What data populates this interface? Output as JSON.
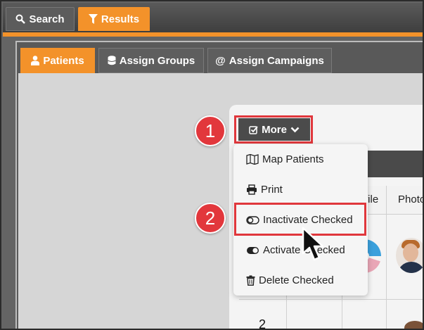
{
  "top_tabs": [
    {
      "label": "Search",
      "icon": "search-icon",
      "active": false
    },
    {
      "label": "Results",
      "icon": "filter-icon",
      "active": true
    }
  ],
  "sub_tabs": [
    {
      "label": "Patients",
      "icon": "user-icon",
      "active": true
    },
    {
      "label": "Assign Groups",
      "icon": "database-icon",
      "active": false
    },
    {
      "label": "Assign Campaigns",
      "icon": "at-icon",
      "active": false
    }
  ],
  "more_button": {
    "label": "More",
    "icon": "check-square-icon",
    "chevron": "chevron-down-icon"
  },
  "menu": {
    "items": [
      {
        "label": "Map Patients",
        "icon": "map-icon"
      },
      {
        "label": "Print",
        "icon": "print-icon"
      },
      {
        "label": "Inactivate Checked",
        "icon": "toggle-off-icon"
      },
      {
        "label": "Activate Checked",
        "icon": "toggle-on-icon"
      },
      {
        "label": "Delete Checked",
        "icon": "trash-icon"
      }
    ]
  },
  "table": {
    "headers": [
      "file",
      "Photo"
    ],
    "row_number": "2"
  },
  "steps": [
    "1",
    "2"
  ],
  "colors": {
    "accent": "#f3922a",
    "highlight": "#e0373c",
    "dark": "#4b4b4b"
  }
}
